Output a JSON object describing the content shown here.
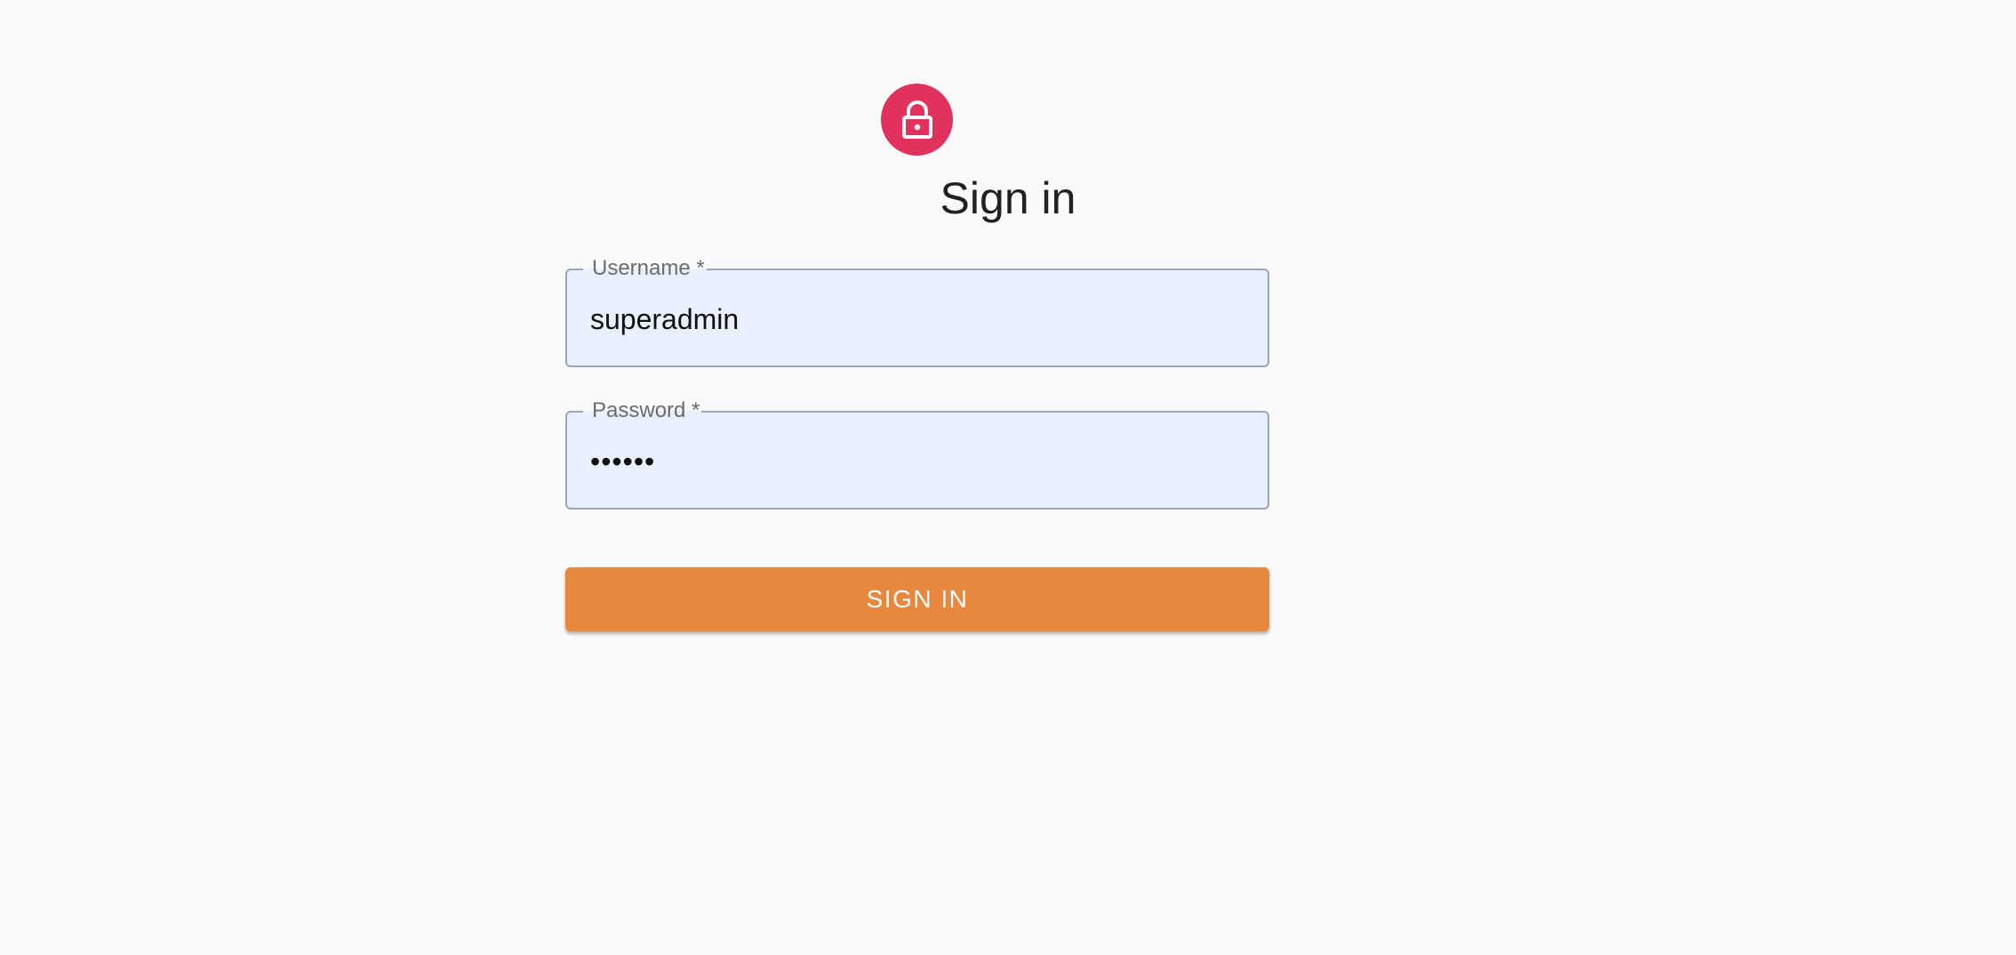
{
  "colors": {
    "background": "#fafafa",
    "avatar": "#e0325c",
    "field_fill": "#e8f0fe",
    "field_border": "#9aa4bd",
    "button": "#e8883e",
    "button_text": "#ffffff"
  },
  "header": {
    "icon": "lock-icon",
    "title": "Sign in"
  },
  "form": {
    "username": {
      "label": "Username *",
      "value": "superadmin"
    },
    "password": {
      "label": "Password *",
      "value": "••••••"
    },
    "submit_label": "SIGN IN"
  }
}
